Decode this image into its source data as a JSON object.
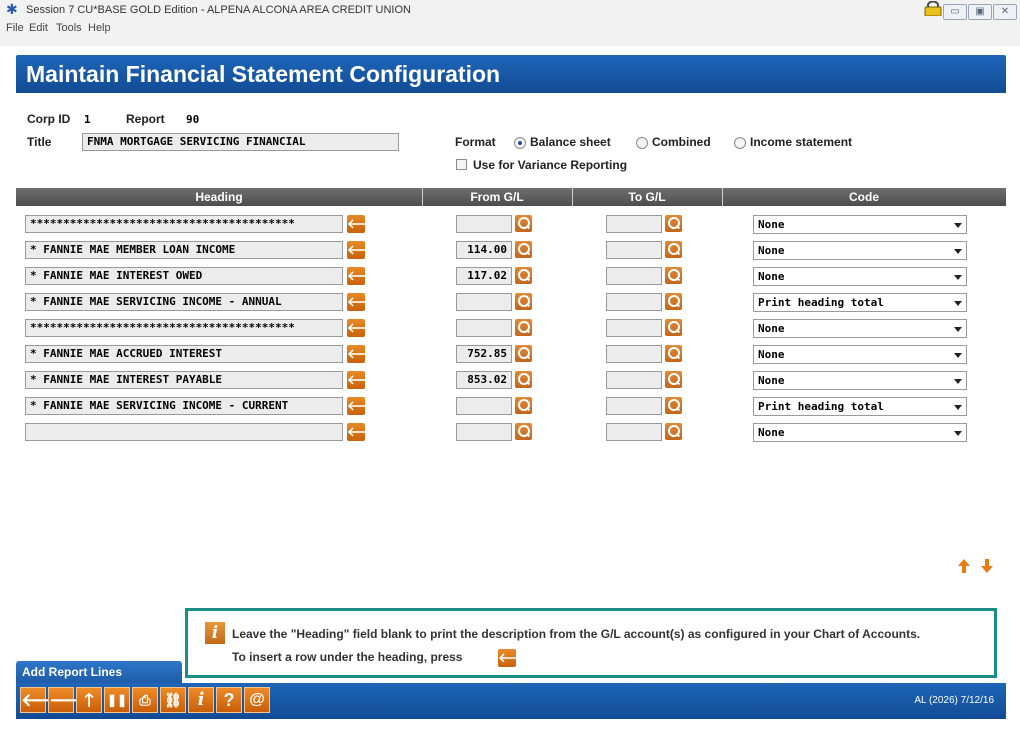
{
  "window": {
    "title": "Session 7 CU*BASE GOLD Edition - ALPENA ALCONA AREA CREDIT UNION",
    "app_icon": "cu-base-star-icon",
    "buttons": [
      "minimize",
      "maximize",
      "close"
    ]
  },
  "menu": {
    "items": [
      "File",
      "Edit",
      "Tools",
      "Help"
    ]
  },
  "header": {
    "title": "Maintain Financial Statement Configuration"
  },
  "form": {
    "corp_id_label": "Corp ID",
    "corp_id_value": "1",
    "report_label": "Report",
    "report_value": "90",
    "title_label": "Title",
    "title_value": "FNMA MORTGAGE SERVICING FINANCIAL",
    "format_label": "Format",
    "format_options": [
      "Balance sheet",
      "Combined",
      "Income statement"
    ],
    "format_selected": "Balance sheet",
    "variance_label": "Use for Variance Reporting",
    "variance_checked": false
  },
  "table": {
    "columns": [
      "Heading",
      "From G/L",
      "To G/L",
      "Code"
    ],
    "rows": [
      {
        "heading": "****************************************",
        "from_gl": "",
        "to_gl": "",
        "code": "None"
      },
      {
        "heading": "* FANNIE MAE MEMBER LOAN INCOME",
        "from_gl": "114.00",
        "to_gl": "",
        "code": "None"
      },
      {
        "heading": "* FANNIE MAE INTEREST OWED",
        "from_gl": "117.02",
        "to_gl": "",
        "code": "None"
      },
      {
        "heading": "* FANNIE MAE SERVICING INCOME - ANNUAL",
        "from_gl": "",
        "to_gl": "",
        "code": "Print heading total"
      },
      {
        "heading": "****************************************",
        "from_gl": "",
        "to_gl": "",
        "code": "None"
      },
      {
        "heading": "* FANNIE MAE ACCRUED INTEREST",
        "from_gl": "752.85",
        "to_gl": "",
        "code": "None"
      },
      {
        "heading": "* FANNIE MAE INTEREST PAYABLE",
        "from_gl": "853.02",
        "to_gl": "",
        "code": "None"
      },
      {
        "heading": "* FANNIE MAE SERVICING INCOME - CURRENT",
        "from_gl": "",
        "to_gl": "",
        "code": "Print heading total"
      },
      {
        "heading": "",
        "from_gl": "",
        "to_gl": "",
        "code": "None"
      }
    ]
  },
  "info": {
    "line1": "Leave the \"Heading\" field blank to print the description from the G/L account(s) as configured in your Chart of Accounts.",
    "line2": "To insert a row under the heading, press"
  },
  "tab": {
    "label": "Add Report Lines"
  },
  "footer": {
    "buttons": [
      "back-arrow-icon",
      "forward-arrow-icon",
      "up-arrow-icon",
      "pause-icon",
      "print-icon",
      "link-icon",
      "info-icon",
      "help-icon",
      "at-icon"
    ],
    "status": "AL (2026) 7/12/16"
  },
  "colors": {
    "brand_blue": "#1e66b8",
    "accent_orange": "#e88a25",
    "info_border": "#1a8e87"
  }
}
